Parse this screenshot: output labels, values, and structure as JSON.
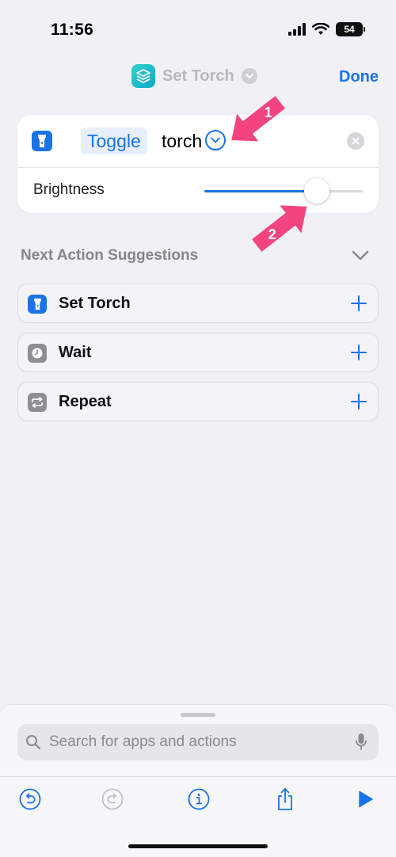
{
  "status": {
    "time": "11:56",
    "battery": "54"
  },
  "nav": {
    "title": "Set Torch",
    "done_label": "Done"
  },
  "action": {
    "mode": "Toggle",
    "object": "torch",
    "brightness_label": "Brightness",
    "brightness_value": 0.71
  },
  "callouts": [
    {
      "label": "1"
    },
    {
      "label": "2"
    }
  ],
  "suggestions": {
    "header": "Next Action Suggestions",
    "items": [
      {
        "label": "Set Torch",
        "icon": "flashlight-icon",
        "color": "#1a73e8"
      },
      {
        "label": "Wait",
        "icon": "clock-icon",
        "color": "#8e8e93"
      },
      {
        "label": "Repeat",
        "icon": "repeat-icon",
        "color": "#8e8e93"
      }
    ]
  },
  "search": {
    "placeholder": "Search for apps and actions"
  },
  "toolbar": {
    "buttons": [
      "undo-icon",
      "redo-icon",
      "info-icon",
      "share-icon",
      "play-icon"
    ]
  },
  "colors": {
    "accent": "#1a73e8",
    "callout": "#f2457f"
  }
}
